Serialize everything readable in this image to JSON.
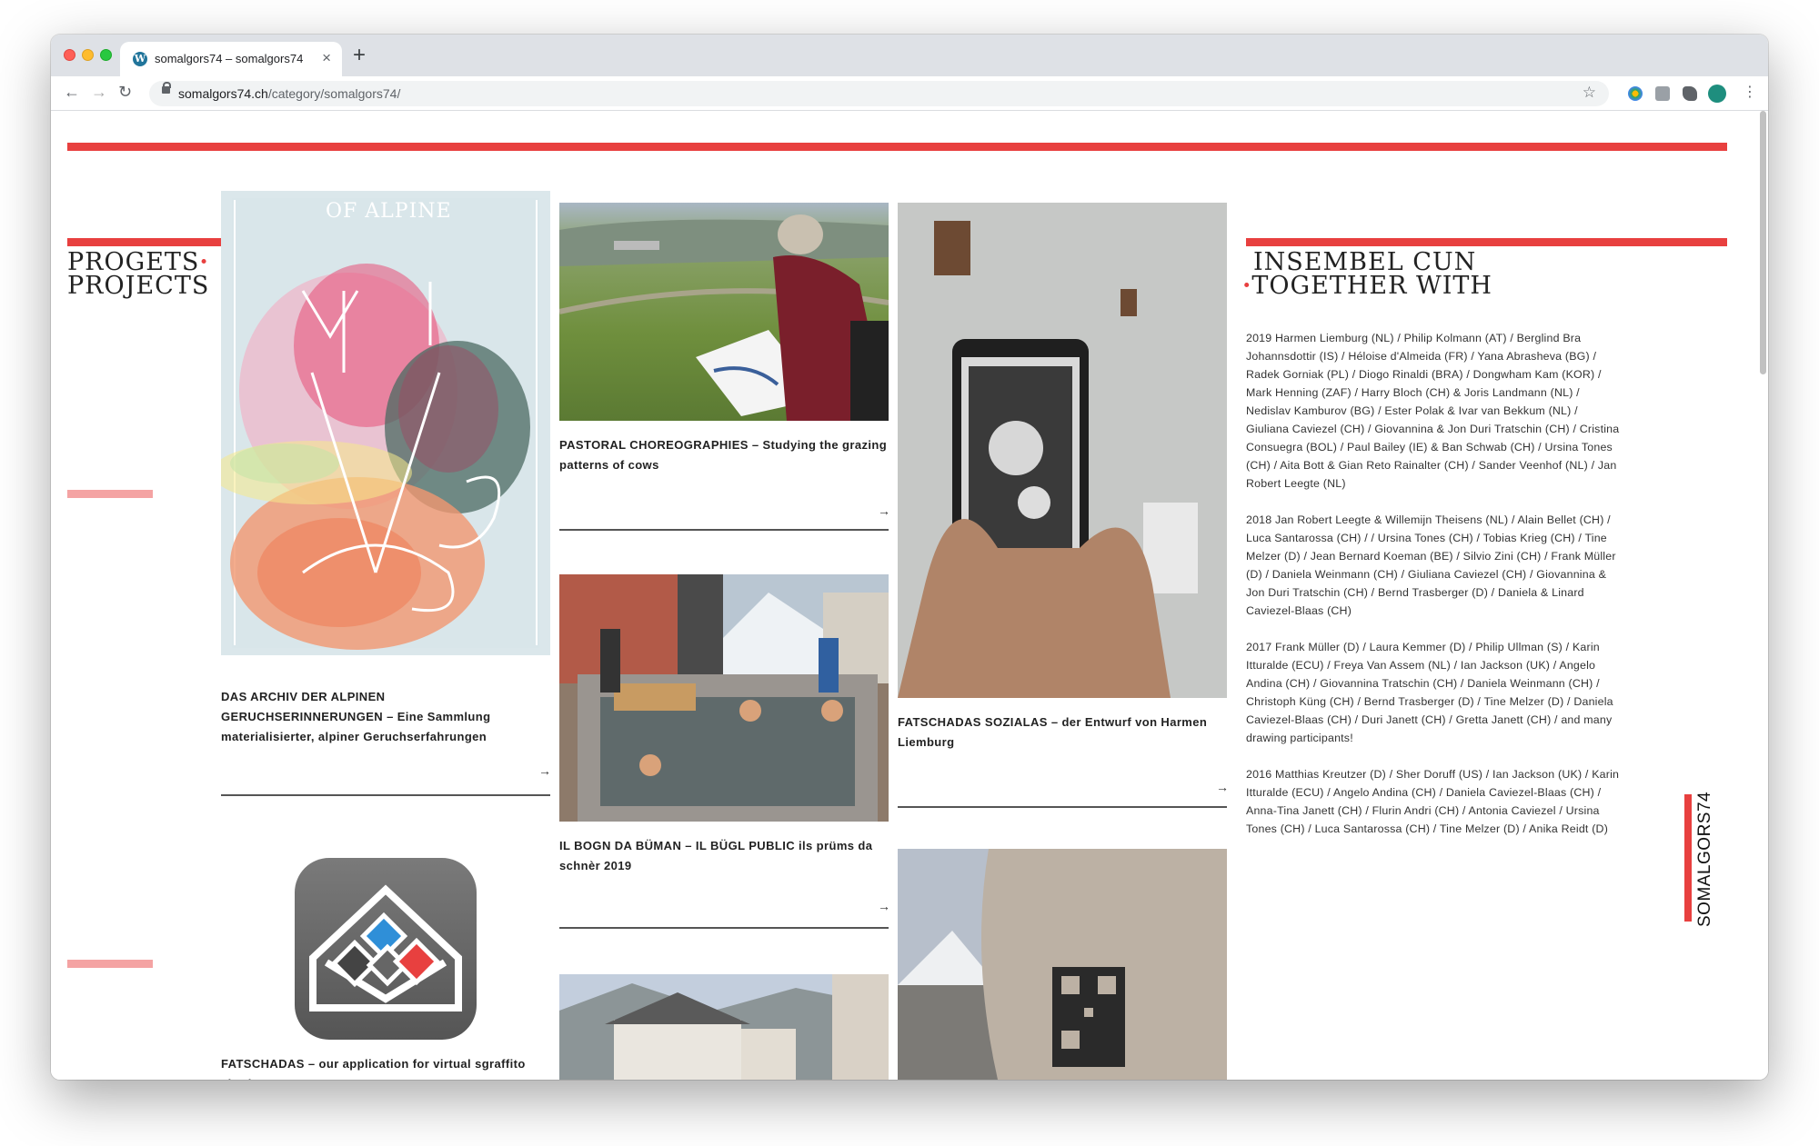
{
  "browser": {
    "tab_title": "somalgors74 – somalgors74",
    "url_host": "somalgors74.ch",
    "url_path": "/category/somalgors74/"
  },
  "colors": {
    "accent_red": "#e8403f",
    "accent_pink": "#f4a3a3"
  },
  "projects_heading": {
    "line1": "PROGETS",
    "line2": "PROJECTS"
  },
  "together_heading": {
    "line1": "INSEMBEL CUN",
    "line2": "TOGETHER WITH"
  },
  "poster": {
    "text": "OF ALPINE"
  },
  "projects": [
    {
      "caption": "DAS ARCHIV DER ALPINEN GERUCHSERINNERUNGEN – Eine Sammlung materialisierter, alpiner Geruchserfahrungen",
      "arrow": "→"
    },
    {
      "caption": "FATSCHADAS – our application for virtual sgraffito viewing",
      "arrow": "→"
    },
    {
      "caption": "PASTORAL CHOREOGRAPHIES – Studying the grazing patterns of cows",
      "arrow": "→"
    },
    {
      "caption": "IL BOGN DA BÜMAN – IL BÜGL PUBLIC ils prüms da schnèr 2019",
      "arrow": "→"
    },
    {
      "caption": "FATSCHADAS SOZIALAS – der Entwurf von Harmen Liemburg",
      "arrow": "→"
    }
  ],
  "collaborators": [
    "2019 Harmen Liemburg (NL) / Philip Kolmann (AT) / Berglind Bra Johannsdottir (IS) / Héloise d'Almeida (FR) / Yana Abrasheva (BG) / Radek Gorniak (PL) / Diogo Rinaldi (BRA) / Dongwham Kam (KOR) / Mark Henning (ZAF) / Harry Bloch (CH) & Joris Landmann (NL) / Nedislav Kamburov (BG) / Ester Polak & Ivar van Bekkum (NL) / Giuliana Caviezel (CH) / Giovannina & Jon Duri Tratschin (CH) / Cristina Consuegra (BOL) / Paul Bailey (IE) & Ban Schwab (CH) / Ursina Tones (CH) / Aita Bott & Gian Reto Rainalter (CH) / Sander Veenhof (NL) / Jan Robert Leegte (NL)",
    "2018 Jan Robert Leegte & Willemijn Theisens (NL) / Alain Bellet (CH) / Luca Santarossa (CH) / / Ursina Tones (CH) / Tobias Krieg (CH) / Tine Melzer (D) / Jean Bernard Koeman (BE) / Silvio Zini (CH) / Frank Müller (D) / Daniela Weinmann (CH) / Giuliana Caviezel (CH) / Giovannina & Jon Duri Tratschin (CH) / Bernd Trasberger (D) / Daniela & Linard Caviezel-Blaas (CH)",
    "2017 Frank Müller (D) / Laura Kemmer (D) / Philip Ullman (S) / Karin Itturalde (ECU) / Freya Van Assem (NL) / Ian Jackson (UK) / Angelo Andina (CH) / Giovannina Tratschin (CH) / Daniela Weinmann (CH) / Christoph Küng (CH) / Bernd Trasberger (D) / Tine Melzer (D) / Daniela Caviezel-Blaas (CH) / Duri Janett (CH) / Gretta Janett (CH) / and many drawing participants!",
    "2016 Matthias Kreutzer (D) / Sher Doruff (US) / Ian Jackson (UK) / Karin Itturalde (ECU) / Angelo Andina (CH) / Daniela Caviezel-Blaas (CH) / Anna-Tina Janett (CH) / Flurin Andri (CH) / Antonia Caviezel / Ursina Tones (CH) / Luca Santarossa (CH) / Tine Melzer (D) / Anika Reidt (D)"
  ],
  "brand_vertical": "SOMALGORS74"
}
